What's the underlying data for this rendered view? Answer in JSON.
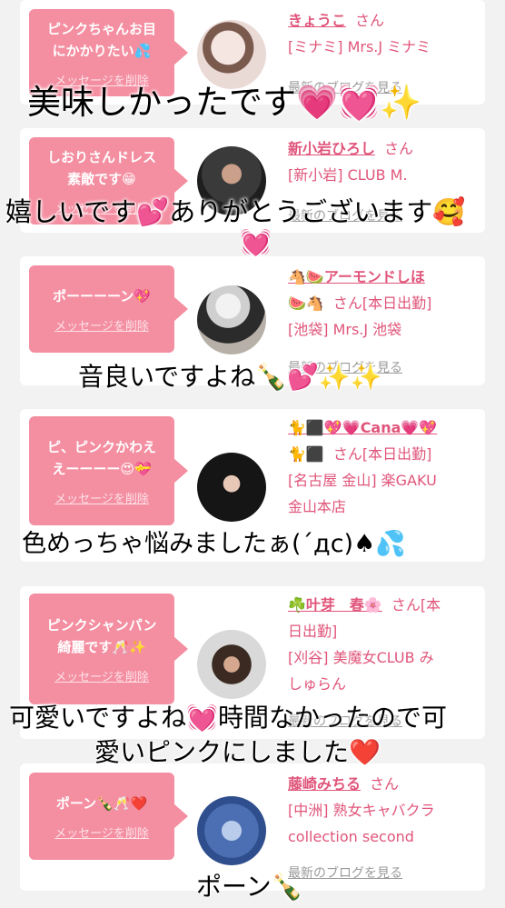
{
  "delete_label": "メッセージを削除",
  "blog_label": "最新のブログを見る",
  "san_label": "さん",
  "accent_color": "#f48ea1",
  "cards": [
    {
      "message": "ピンクちゃんお目\nにかかりたい💦",
      "name": "きょうこ",
      "name_suffix": "",
      "shop": "[ミナミ] Mrs.J ミナミ",
      "caption": "美味しかったです💗💓✨"
    },
    {
      "message": "しおりさんドレス\n素敵です😁",
      "name": "新小岩ひろし",
      "name_suffix": "",
      "shop": "[新小岩] CLUB M.",
      "caption": "嬉しいです💕ありがとうございます🥰",
      "caption2": "💓"
    },
    {
      "message": "ポーーーーン💖",
      "name": "🐴🍉アーモンドしほ",
      "name_line2": "🍉🐴",
      "name_suffix": "[本日出勤]",
      "shop": "[池袋] Mrs.J 池袋",
      "caption": "音良いですよね🍾💕✨✨"
    },
    {
      "message": "ピ、ピンクかわえ\nえーーーー😍💝",
      "name": "🐈⬛💖💗Cana💗💖",
      "name_line2": "🐈⬛",
      "name_suffix": "[本日出勤]",
      "shop": "[名古屋 金山] 楽GAKU",
      "shop2": "金山本店",
      "caption": "色めっちゃ悩みましたぁ(´дc)♠💦"
    },
    {
      "message": "ピンクシャンパン\n綺麗です🥂✨",
      "name": "☘️叶芽　春🌸",
      "name_suffix": "[本",
      "name_line2b": "日出勤]",
      "shop": "[刈谷] 美魔女CLUB み",
      "shop2": "しゅらん",
      "caption": "可愛いですよね💓時間なかったので可",
      "caption2": "愛いピンクにしました❤️"
    },
    {
      "message": "ポーン🍾🥂❤️",
      "name": "藤崎みちる",
      "name_suffix": "",
      "shop": "[中洲] 熟女キャバクラ",
      "shop2": "collection second",
      "caption": "ポーン🍾"
    }
  ]
}
